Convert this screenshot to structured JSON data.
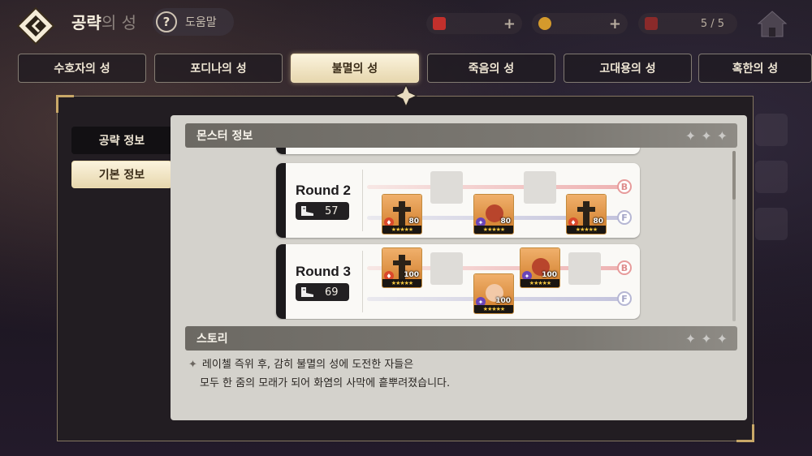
{
  "header": {
    "title": "공략",
    "title_faded": "의 성",
    "help_label": "도움말",
    "stamina_value": "5 / 5"
  },
  "tabs": [
    {
      "label": "수호자의 성",
      "active": false
    },
    {
      "label": "포디나의 성",
      "active": false
    },
    {
      "label": "불멸의 성",
      "active": true
    },
    {
      "label": "죽음의 성",
      "active": false
    },
    {
      "label": "고대용의 성",
      "active": false
    },
    {
      "label": "혹한의 성",
      "active": false
    }
  ],
  "side_tabs": [
    {
      "label": "공략 정보",
      "active": false
    },
    {
      "label": "기본 정보",
      "active": true
    }
  ],
  "monster_section": {
    "title": "몬스터 정보",
    "lane_back": "B",
    "lane_front": "F",
    "rounds": [
      {
        "name": "Round 2",
        "power": "57",
        "units": [
          {
            "kind": "knight",
            "element": "fire",
            "level": "80",
            "lane": "front",
            "pos": 0
          },
          {
            "kind": "fox",
            "element": "dark",
            "level": "80",
            "lane": "front",
            "pos": 1
          },
          {
            "kind": "knight",
            "element": "fire",
            "level": "80",
            "lane": "front",
            "pos": 2
          }
        ]
      },
      {
        "name": "Round 3",
        "power": "69",
        "units": [
          {
            "kind": "knight",
            "element": "fire",
            "level": "100",
            "lane": "back",
            "pos": 0
          },
          {
            "kind": "fox",
            "element": "dark",
            "level": "100",
            "lane": "back",
            "pos": 2
          },
          {
            "kind": "queen",
            "element": "dark",
            "level": "100",
            "lane": "front",
            "pos": 1
          }
        ]
      }
    ]
  },
  "story_section": {
    "title": "스토리",
    "line1": "레이첼 즉위 후, 감히 불멸의 성에 도전한 자들은",
    "line2": "모두 한 줌의 모래가 되어 화염의 사막에 흩뿌려졌습니다."
  },
  "colors": {
    "active_tab": "#e7d7ae",
    "panel": "#d4d2cc",
    "lane_back": "#eeb1b1",
    "lane_front": "#c2c2dc",
    "element_fire": "#d9482b",
    "element_dark": "#6a45b8"
  }
}
